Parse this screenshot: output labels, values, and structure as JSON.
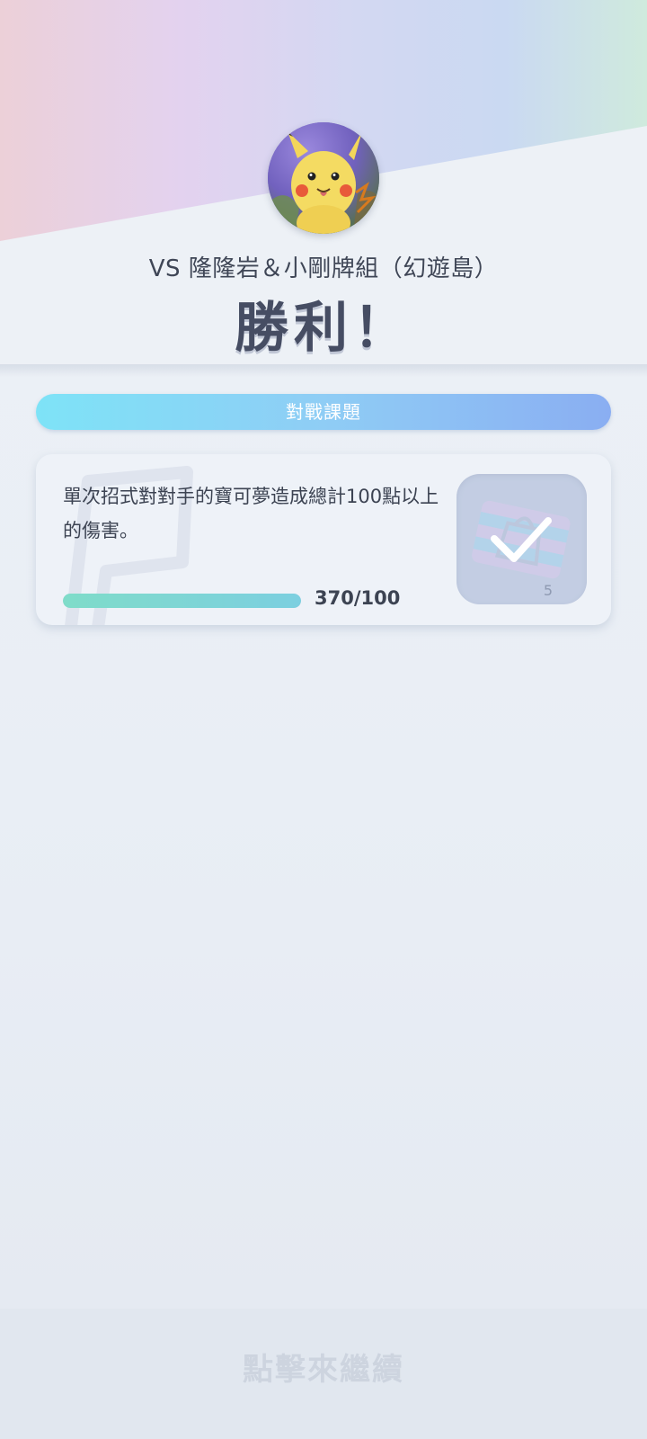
{
  "header": {
    "opponent_title": "VS 隆隆岩＆小剛牌組（幻遊島）",
    "result": "勝利！"
  },
  "avatar": {
    "icon": "pikachu-avatar"
  },
  "missions": {
    "section_label": "對戰課題",
    "items": [
      {
        "description": "單次招式對對手的寶可夢造成總計100點以上的傷害。",
        "progress_text": "370/100",
        "progress_fraction": 1.0,
        "reward_count": "5",
        "status_icon": "checkmark-icon"
      }
    ]
  },
  "footer": {
    "hint": "點擊來繼續"
  },
  "colors": {
    "title_text": "#464d63",
    "bar_start": "#7ee3f7",
    "bar_end": "#8aaef2",
    "progress_fill": "#7fdcc9"
  }
}
